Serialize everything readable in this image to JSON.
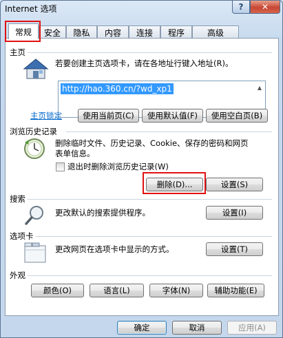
{
  "window": {
    "title": "Internet 选项",
    "help": "?",
    "close": "✕"
  },
  "tabs": [
    {
      "label": "常规"
    },
    {
      "label": "安全"
    },
    {
      "label": "隐私"
    },
    {
      "label": "内容"
    },
    {
      "label": "连接"
    },
    {
      "label": "程序"
    },
    {
      "label": "高级"
    }
  ],
  "home": {
    "title": "主页",
    "desc": "若要创建主页选项卡，请在各地址行键入地址(R)。",
    "url": "http://hao.360.cn/?wd_xp1",
    "lock_link": "主页锁定",
    "use_current": "使用当前页(C)",
    "use_default": "使用默认值(F)",
    "use_blank": "使用空白页(B)"
  },
  "history": {
    "title": "浏览历史记录",
    "desc_line1": "删除临时文件、历史记录、Cookie、保存的密码和网页",
    "desc_line2": "表单信息。",
    "checkbox_label": "退出时删除浏览历史记录(W)",
    "delete": "删除(D)...",
    "settings": "设置(S)"
  },
  "search": {
    "title": "搜索",
    "desc": "更改默认的搜索提供程序。",
    "settings": "设置(I)"
  },
  "tabs_section": {
    "title": "选项卡",
    "desc": "更改网页在选项卡中显示的方式。",
    "settings": "设置(T)"
  },
  "appearance": {
    "title": "外观",
    "colors": "颜色(O)",
    "languages": "语言(L)",
    "fonts": "字体(N)",
    "accessibility": "辅助功能(E)"
  },
  "footer": {
    "ok": "确定",
    "cancel": "取消",
    "apply": "应用(A)"
  }
}
